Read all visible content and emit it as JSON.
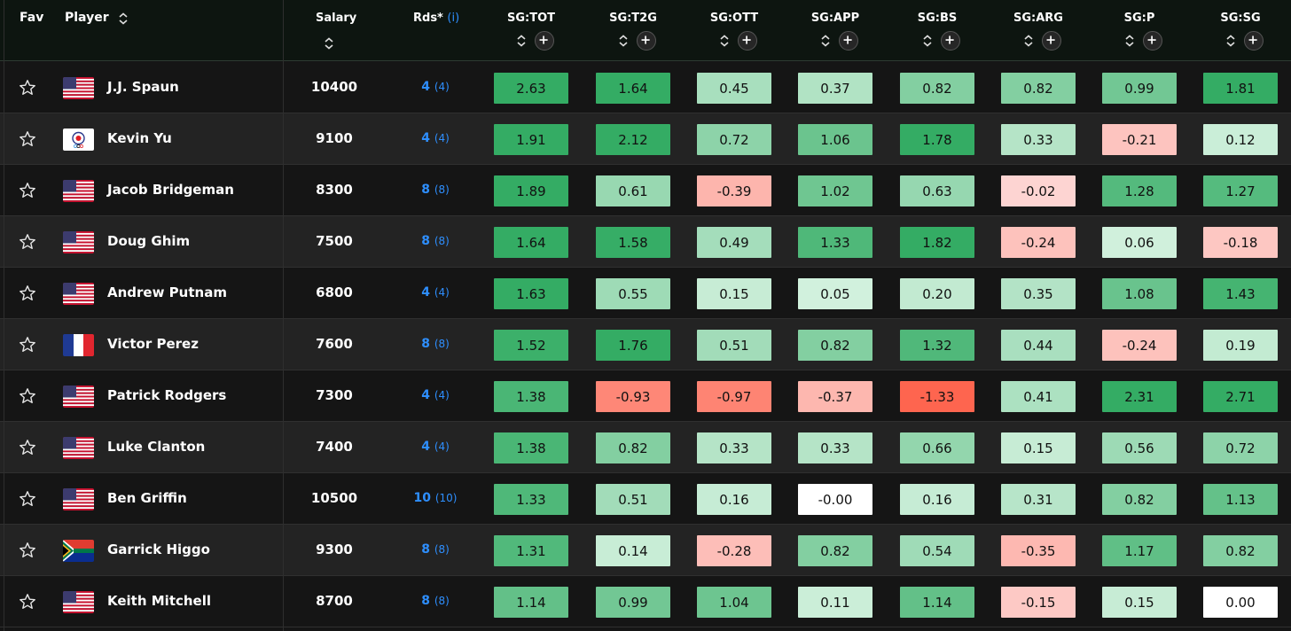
{
  "header": {
    "fav": "Fav",
    "player": "Player",
    "salary": "Salary",
    "rds": "Rds*",
    "rds_info": "(i)",
    "stats": [
      "SG:TOT",
      "SG:T2G",
      "SG:OTT",
      "SG:APP",
      "SG:BS",
      "SG:ARG",
      "SG:P",
      "SG:SG"
    ]
  },
  "icons": {
    "fav": "star-outline-icon",
    "sort": "sort-arrows-icon",
    "add": "plus-circle-icon"
  },
  "colors": {
    "green_strong": "#3bb36b",
    "green_mid": "#6dca92",
    "green_light": "#c2ebd2",
    "neutral": "#ffffff",
    "red_light": "#fdc8c6",
    "red_mid": "#fc8f82",
    "red_strong": "#ff3c1e"
  },
  "rows": [
    {
      "name": "J.J. Spaun",
      "flag": "usa-flag-icon",
      "salary": "10400",
      "rds": "4",
      "rds_sub": "(4)",
      "sg": [
        "2.63",
        "1.64",
        "0.45",
        "0.37",
        "0.82",
        "0.82",
        "0.99",
        "1.81"
      ]
    },
    {
      "name": "Kevin Yu",
      "flag": "chinese-taipei-flag-icon",
      "salary": "9100",
      "rds": "4",
      "rds_sub": "(4)",
      "sg": [
        "1.91",
        "2.12",
        "0.72",
        "1.06",
        "1.78",
        "0.33",
        "-0.21",
        "0.12"
      ]
    },
    {
      "name": "Jacob Bridgeman",
      "flag": "usa-flag-icon",
      "salary": "8300",
      "rds": "8",
      "rds_sub": "(8)",
      "sg": [
        "1.89",
        "0.61",
        "-0.39",
        "1.02",
        "0.63",
        "-0.02",
        "1.28",
        "1.27"
      ]
    },
    {
      "name": "Doug Ghim",
      "flag": "usa-flag-icon",
      "salary": "7500",
      "rds": "8",
      "rds_sub": "(8)",
      "sg": [
        "1.64",
        "1.58",
        "0.49",
        "1.33",
        "1.82",
        "-0.24",
        "0.06",
        "-0.18"
      ]
    },
    {
      "name": "Andrew Putnam",
      "flag": "usa-flag-icon",
      "salary": "6800",
      "rds": "4",
      "rds_sub": "(4)",
      "sg": [
        "1.63",
        "0.55",
        "0.15",
        "0.05",
        "0.20",
        "0.35",
        "1.08",
        "1.43"
      ]
    },
    {
      "name": "Victor Perez",
      "flag": "france-flag-icon",
      "salary": "7600",
      "rds": "8",
      "rds_sub": "(8)",
      "sg": [
        "1.52",
        "1.76",
        "0.51",
        "0.82",
        "1.32",
        "0.44",
        "-0.24",
        "0.19"
      ]
    },
    {
      "name": "Patrick Rodgers",
      "flag": "usa-flag-icon",
      "salary": "7300",
      "rds": "4",
      "rds_sub": "(4)",
      "sg": [
        "1.38",
        "-0.93",
        "-0.97",
        "-0.37",
        "-1.33",
        "0.41",
        "2.31",
        "2.71"
      ]
    },
    {
      "name": "Luke Clanton",
      "flag": "usa-flag-icon",
      "salary": "7400",
      "rds": "4",
      "rds_sub": "(4)",
      "sg": [
        "1.38",
        "0.82",
        "0.33",
        "0.33",
        "0.66",
        "0.15",
        "0.56",
        "0.72"
      ]
    },
    {
      "name": "Ben Griffin",
      "flag": "usa-flag-icon",
      "salary": "10500",
      "rds": "10",
      "rds_sub": "(10)",
      "sg": [
        "1.33",
        "0.51",
        "0.16",
        "-0.00",
        "0.16",
        "0.31",
        "0.82",
        "1.13"
      ]
    },
    {
      "name": "Garrick Higgo",
      "flag": "south-africa-flag-icon",
      "salary": "9300",
      "rds": "8",
      "rds_sub": "(8)",
      "sg": [
        "1.31",
        "0.14",
        "-0.28",
        "0.82",
        "0.54",
        "-0.35",
        "1.17",
        "0.82"
      ]
    },
    {
      "name": "Keith Mitchell",
      "flag": "usa-flag-icon",
      "salary": "8700",
      "rds": "8",
      "rds_sub": "(8)",
      "sg": [
        "1.14",
        "0.99",
        "1.04",
        "0.11",
        "1.14",
        "-0.15",
        "0.15",
        "0.00"
      ]
    }
  ]
}
